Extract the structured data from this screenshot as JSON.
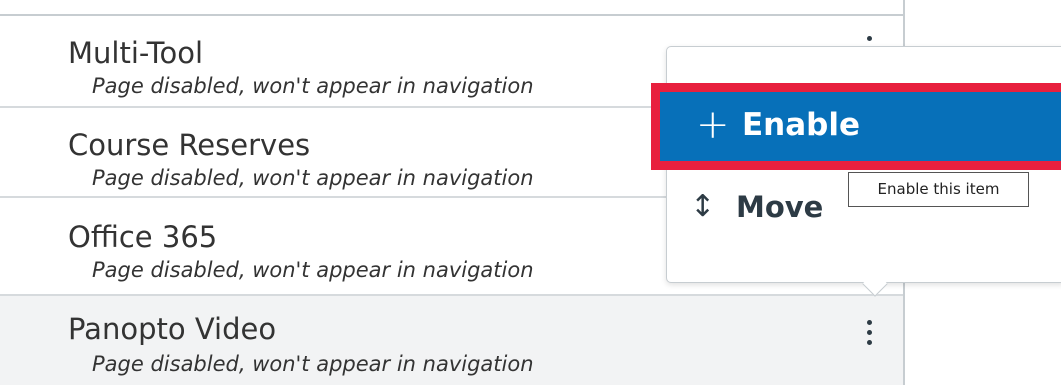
{
  "nav_items": [
    {
      "name": "Multi-Tool",
      "status": "Page disabled, won't appear in navigation"
    },
    {
      "name": "Course Reserves",
      "status": "Page disabled, won't appear in navigation"
    },
    {
      "name": "Office 365",
      "status": "Page disabled, won't appear in navigation"
    },
    {
      "name": "Panopto Video",
      "status": "Page disabled, won't appear in navigation"
    }
  ],
  "menu": {
    "enable_icon": "+",
    "enable_label": "Enable",
    "move_icon": "↕",
    "move_label": "Move"
  },
  "tooltip": {
    "text": "Enable this item"
  },
  "colors": {
    "enable_bg": "#0770b9",
    "highlight_border": "#e8203e",
    "row_highlight": "#f2f3f4"
  }
}
